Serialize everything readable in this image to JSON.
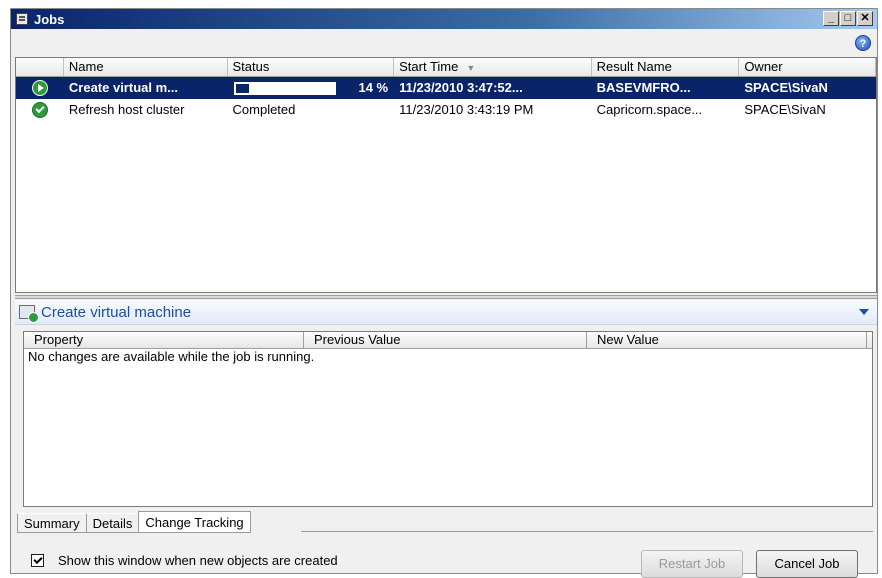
{
  "window": {
    "title": "Jobs"
  },
  "jobs_grid": {
    "columns": [
      "Name",
      "Status",
      "Start Time",
      "Result Name",
      "Owner"
    ],
    "rows": [
      {
        "name": "Create virtual m...",
        "status_progress": 14,
        "status_text": "14 %",
        "start_time": "11/23/2010 3:47:52...",
        "result_name": "BASEVMFRO...",
        "owner": "SPACE\\SivaN"
      },
      {
        "name": "Refresh host cluster",
        "status_text": "Completed",
        "start_time": "11/23/2010 3:43:19 PM",
        "result_name": "Capricorn.space...",
        "owner": "SPACE\\SivaN"
      }
    ]
  },
  "detail": {
    "title": "Create virtual machine"
  },
  "changes": {
    "columns": [
      "Property",
      "Previous Value",
      "New Value"
    ],
    "message": "No changes are available while the job is running."
  },
  "tabs": [
    "Summary",
    "Details",
    "Change Tracking"
  ],
  "footer": {
    "checkbox_label": "Show this window when new objects are created",
    "restart_label": "Restart Job",
    "cancel_label": "Cancel Job"
  }
}
